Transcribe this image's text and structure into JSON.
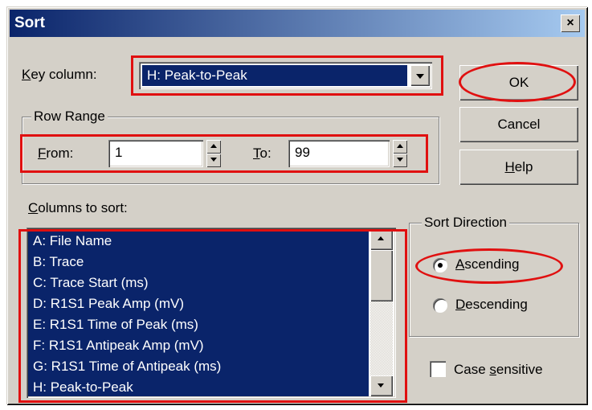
{
  "window": {
    "title": "Sort",
    "close_glyph": "×"
  },
  "key_column": {
    "label_prefix": "",
    "label_u": "K",
    "label_rest": "ey column:",
    "value": "H: Peak-to-Peak"
  },
  "row_range": {
    "group_label": "Row Range",
    "from_u": "F",
    "from_rest": "rom:",
    "from_value": "1",
    "to_u": "T",
    "to_rest": "o:",
    "to_value": "99"
  },
  "buttons": {
    "ok": "OK",
    "cancel": "Cancel",
    "help_u": "H",
    "help_rest": "elp"
  },
  "columns": {
    "label_u": "C",
    "label_rest": "olumns to sort:",
    "items": [
      "A: File Name",
      "B: Trace",
      "C: Trace Start (ms)",
      "D: R1S1 Peak Amp (mV)",
      "E: R1S1 Time of Peak (ms)",
      "F: R1S1 Antipeak Amp (mV)",
      "G: R1S1 Time of Antipeak (ms)",
      "H: Peak-to-Peak"
    ]
  },
  "sort_direction": {
    "group_label": "Sort Direction",
    "asc_u": "A",
    "asc_rest": "scending",
    "desc_u": "D",
    "desc_rest": "escending",
    "selected": "Ascending"
  },
  "case_sensitive": {
    "prefix": "Case ",
    "u": "s",
    "rest": "ensitive",
    "checked": false
  },
  "colors": {
    "selection": "#0a246a",
    "annotation": "#e01010",
    "face": "#d4d0c8"
  }
}
